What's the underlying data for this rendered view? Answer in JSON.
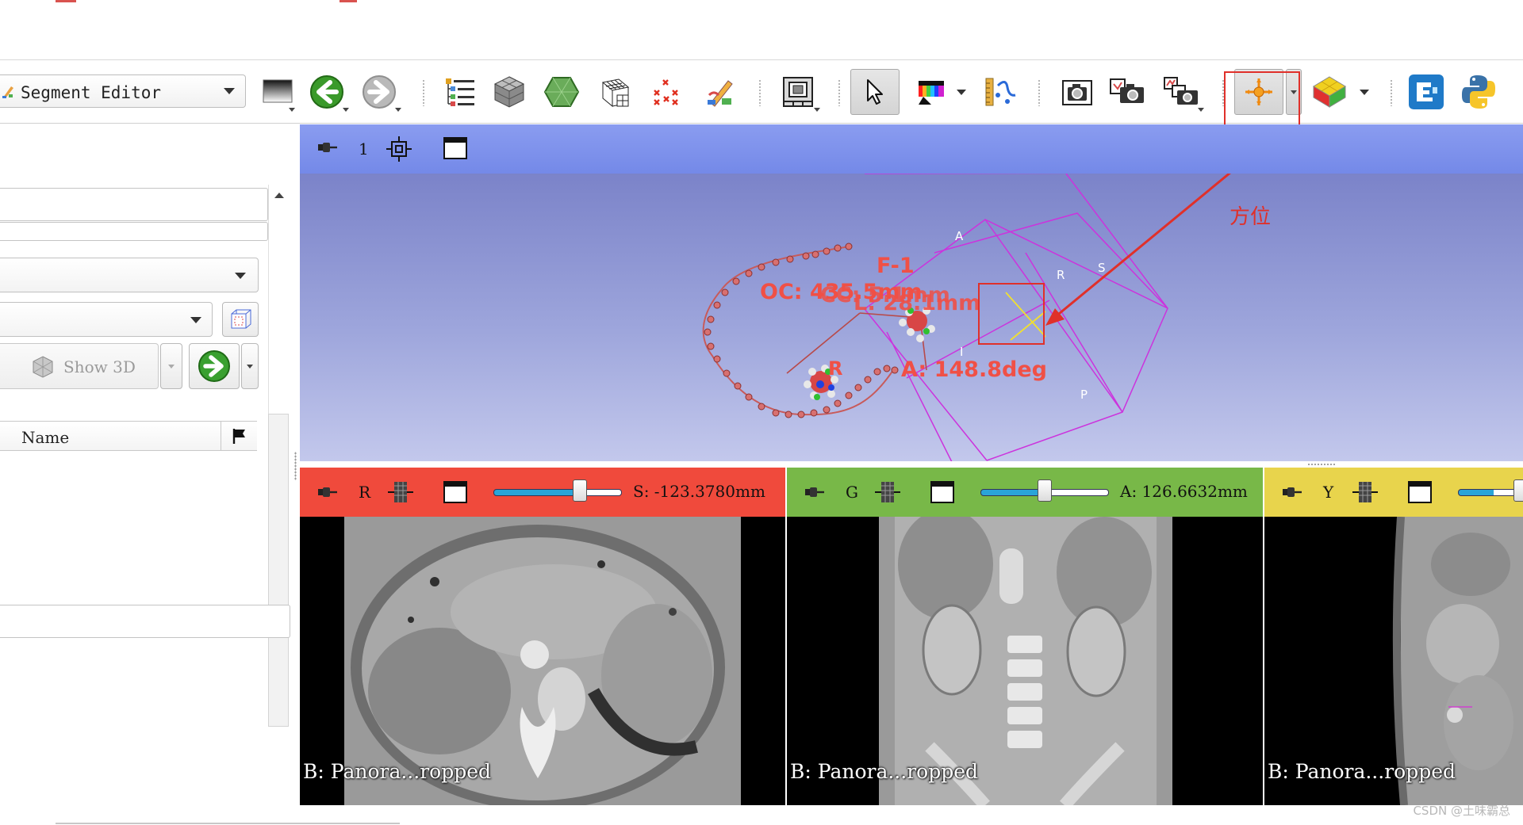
{
  "toolbar": {
    "module_selector_label": "Segment Editor"
  },
  "left_panel": {
    "show3d_label": "Show 3D",
    "name_column_header": "Name"
  },
  "view3d": {
    "view_number": "1",
    "axis_letters": {
      "anterior": "A",
      "right": "R",
      "superior": "S",
      "inferior": "I",
      "posterior": "P"
    },
    "markups": {
      "fiducial_label": "F-1",
      "closed_curve_label": "OC: 435.5mm",
      "line_length_overlay": "L: 28.1mm",
      "curve_overlay_label": "CC: 5.1mm",
      "angle_label": "A: 148.8deg",
      "point_label": "R"
    },
    "annotation_text": "方位"
  },
  "slices": [
    {
      "id": "red",
      "letter": "R",
      "value": "S: -123.3780mm",
      "slider_fraction": 0.68,
      "caption": "B: Panora...ropped"
    },
    {
      "id": "green",
      "letter": "G",
      "value": "A: 126.6632mm",
      "slider_fraction": 0.5,
      "caption": "B: Panora...ropped"
    },
    {
      "id": "yellow",
      "letter": "Y",
      "value": "",
      "slider_fraction": 0.5,
      "caption": "B: Panora...ropped"
    }
  ],
  "colors": {
    "red_slice": "#f04a3c",
    "green_slice": "#78b848",
    "yellow_slice": "#e8d44c",
    "view3d_bar": "#7d91ec",
    "annotation_red": "#e0302a",
    "markup_color": "#f05046"
  },
  "icons": [
    "segment-editor-icon",
    "window-level-icon",
    "back-arrow-icon",
    "forward-arrow-icon",
    "data-module-icon",
    "volumes-icon",
    "models-icon",
    "transforms-icon",
    "markups-icon",
    "editor-icon",
    "layout-icon",
    "mouse-pointer-icon",
    "color-bar-icon",
    "ruler-icon",
    "screenshot-icon",
    "scene-view-icon",
    "capture-icon",
    "place-fiducial-icon",
    "3d-cube-icon",
    "extension-manager-icon",
    "python-icon",
    "pin-icon",
    "center-view-icon",
    "maximize-icon",
    "flag-icon",
    "green-arrow-icon"
  ],
  "watermark": "CSDN @土味霸总"
}
